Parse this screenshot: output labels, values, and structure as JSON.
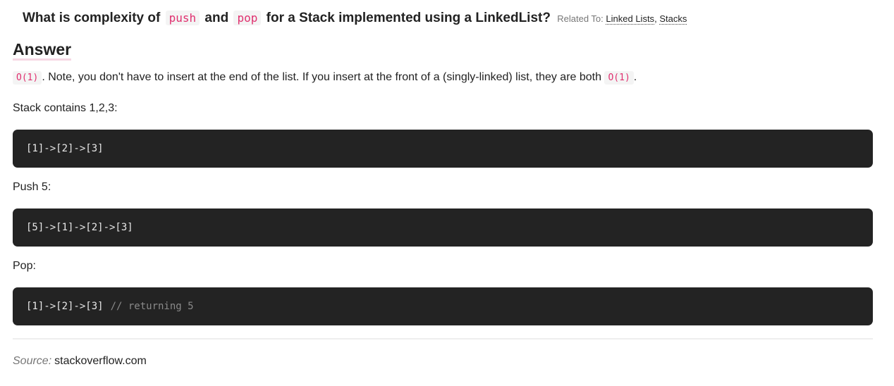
{
  "question": {
    "prefix": "What is complexity of",
    "code_push": "push",
    "and": "and",
    "code_pop": "pop",
    "suffix": "for a Stack implemented using a LinkedList?",
    "related_label": "Related To:",
    "related_links": [
      "Linked Lists",
      "Stacks"
    ],
    "related_sep": ","
  },
  "answer": {
    "heading": "Answer",
    "intro_code": "O(1)",
    "intro_text": ". Note, you don't have to insert at the end of the list. If you insert at the front of a (singly-linked) list, they are both",
    "intro_code2": "O(1)",
    "intro_end": ".",
    "stack_label": "Stack contains 1,2,3:",
    "stack_code": "[1]->[2]->[3]",
    "push_label": "Push 5:",
    "push_code": "[5]->[1]->[2]->[3]",
    "pop_label": "Pop:",
    "pop_code": "[1]->[2]->[3]",
    "pop_comment": "// returning 5"
  },
  "source": {
    "label": "Source:",
    "value": "stackoverflow.com"
  },
  "colors": {
    "inline_code": "#e0306f",
    "code_bg": "#232323",
    "accent_underline": "#f6d8e4"
  }
}
